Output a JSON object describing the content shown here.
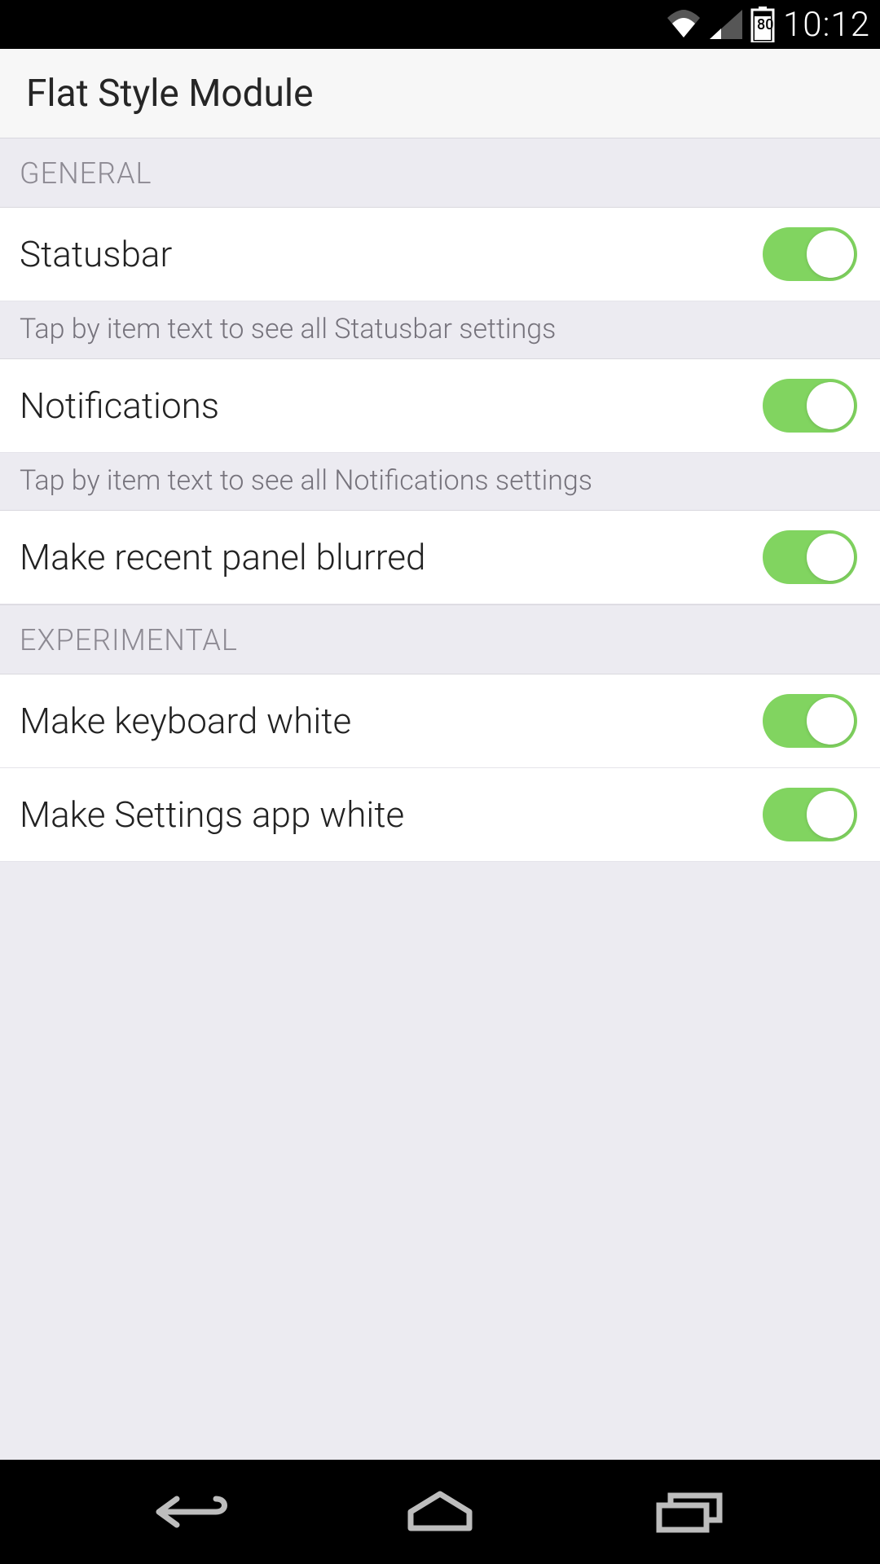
{
  "status": {
    "time": "10:12",
    "battery_pct": "80"
  },
  "app": {
    "title": "Flat Style Module"
  },
  "sections": {
    "general": {
      "header": "GENERAL",
      "statusbar": {
        "label": "Statusbar",
        "hint": "Tap by item text to see all Statusbar settings",
        "on": true
      },
      "notifications": {
        "label": "Notifications",
        "hint": "Tap by item text to see all Notifications settings",
        "on": true
      },
      "recent_blur": {
        "label": "Make recent panel blurred",
        "on": true
      }
    },
    "experimental": {
      "header": "EXPERIMENTAL",
      "keyboard_white": {
        "label": "Make keyboard white",
        "on": true
      },
      "settings_white": {
        "label": "Make Settings app white",
        "on": true
      }
    }
  },
  "colors": {
    "toggle_on": "#81d460",
    "bg": "#ecebf1",
    "row_bg": "#ffffff"
  }
}
